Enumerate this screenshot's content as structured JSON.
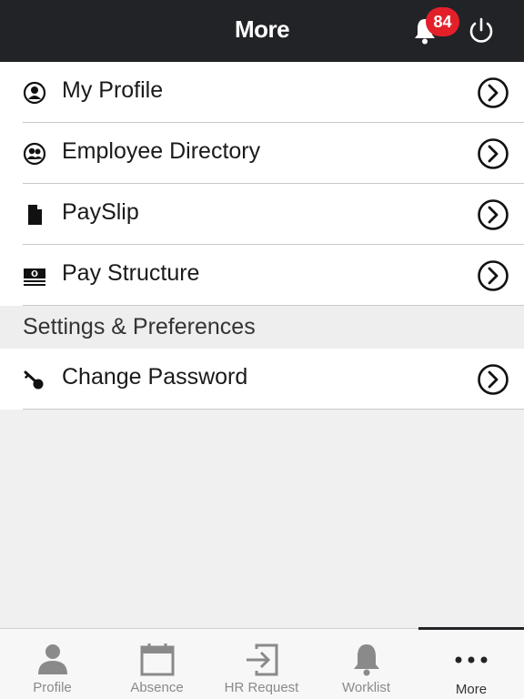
{
  "header": {
    "title": "More",
    "notification_count": "84"
  },
  "menu": {
    "items": [
      {
        "label": "My Profile",
        "icon": "person-circle-icon"
      },
      {
        "label": "Employee Directory",
        "icon": "people-circle-icon"
      },
      {
        "label": "PaySlip",
        "icon": "document-icon"
      },
      {
        "label": "Pay Structure",
        "icon": "money-icon"
      }
    ],
    "section_title": "Settings & Preferences",
    "settings_items": [
      {
        "label": "Change Password",
        "icon": "key-icon"
      }
    ]
  },
  "tabbar": {
    "tabs": [
      {
        "label": "Profile",
        "icon": "person-icon"
      },
      {
        "label": "Absence",
        "icon": "calendar-icon"
      },
      {
        "label": "HR Request",
        "icon": "sign-in-icon"
      },
      {
        "label": "Worklist",
        "icon": "bell-icon"
      },
      {
        "label": "More",
        "icon": "more-dots-icon",
        "active": true
      }
    ]
  },
  "colors": {
    "header_bg": "#222327",
    "badge": "#e3202a",
    "background": "#f0f0f0"
  }
}
